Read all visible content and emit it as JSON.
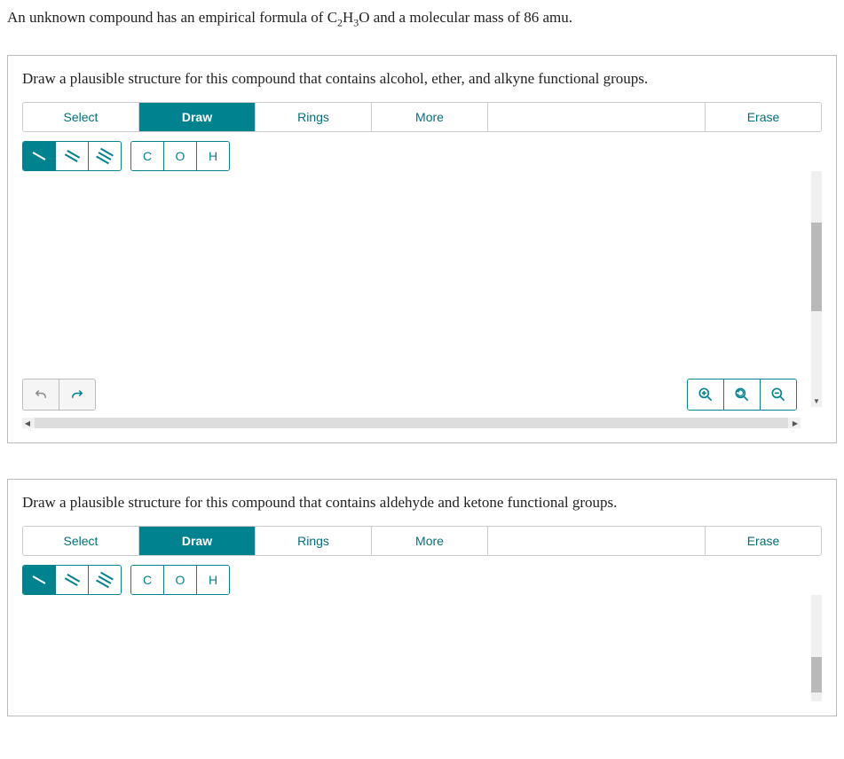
{
  "question": {
    "pre": "An unknown compound has an empirical formula of C",
    "sub1": "2",
    "mid1": "H",
    "sub2": "3",
    "mid2": "O and a molecular mass of 86 amu."
  },
  "panels": [
    {
      "prompt": "Draw a plausible structure for this compound that contains alcohol, ether, and alkyne functional groups.",
      "tabs": {
        "select": "Select",
        "draw": "Draw",
        "rings": "Rings",
        "more": "More",
        "erase": "Erase"
      },
      "atoms": {
        "c": "C",
        "o": "O",
        "h": "H"
      }
    },
    {
      "prompt": "Draw a plausible structure for this compound that contains aldehyde and ketone functional groups.",
      "tabs": {
        "select": "Select",
        "draw": "Draw",
        "rings": "Rings",
        "more": "More",
        "erase": "Erase"
      },
      "atoms": {
        "c": "C",
        "o": "O",
        "h": "H"
      }
    }
  ]
}
